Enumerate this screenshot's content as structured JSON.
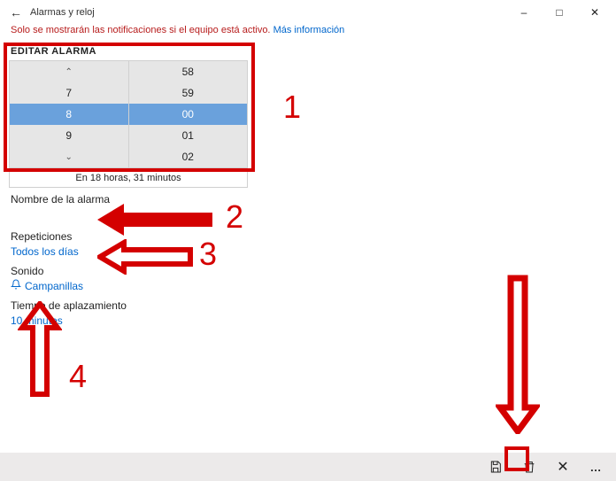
{
  "titlebar": {
    "app_title": "Alarmas y reloj"
  },
  "banner": {
    "text": "Solo se mostrarán las notificaciones si el equipo está activo.",
    "link": "Más información"
  },
  "section_title": "EDITAR ALARMA",
  "time_picker": {
    "hours": {
      "up": "⌃",
      "r1": "7",
      "sel": "8",
      "r3": "9",
      "down": "⌄"
    },
    "minutes": {
      "r0": "58",
      "r1": "59",
      "sel": "00",
      "r3": "01",
      "r4": "02"
    },
    "footer": "En 18 horas, 31 minutos"
  },
  "fields": {
    "name_label": "Nombre de la alarma",
    "repeat_label": "Repeticiones",
    "repeat_value": "Todos los días",
    "sound_label": "Sonido",
    "sound_value": "Campanillas",
    "snooze_label": "Tiempo de aplazamiento",
    "snooze_value": "10 minutos"
  },
  "annotations": {
    "n1": "1",
    "n2": "2",
    "n3": "3",
    "n4": "4"
  }
}
